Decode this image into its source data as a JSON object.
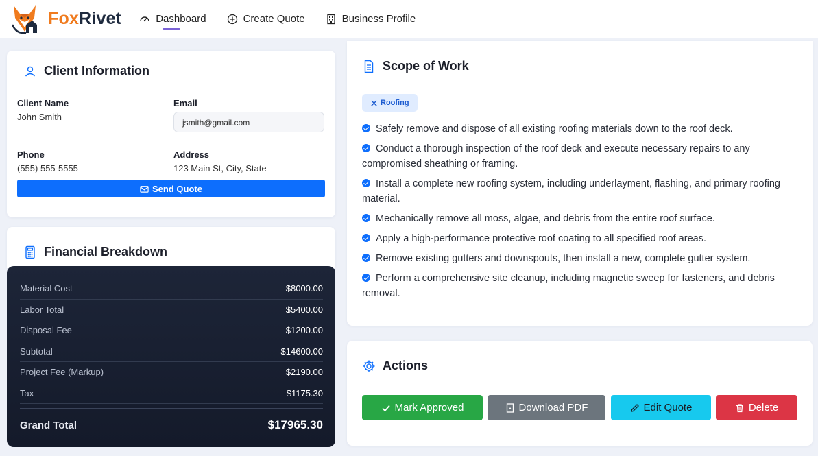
{
  "brand": {
    "name_part1": "Fox",
    "name_part2": "Rivet",
    "accent": "#f07b1e",
    "dark": "#1e2a3e"
  },
  "nav": [
    {
      "label": "Dashboard",
      "icon": "gauge-icon",
      "active": true
    },
    {
      "label": "Create Quote",
      "icon": "plus-circle-icon"
    },
    {
      "label": "Business Profile",
      "icon": "building-icon"
    }
  ],
  "client": {
    "title": "Client Information",
    "name_label": "Client Name",
    "name": "John Smith",
    "email_label": "Email",
    "email": "jsmith@gmail.com",
    "phone_label": "Phone",
    "phone": "(555) 555-5555",
    "address_label": "Address",
    "address": "123 Main St, City, State",
    "send_label": "Send Quote"
  },
  "financial": {
    "title": "Financial Breakdown",
    "rows": [
      {
        "label": "Material Cost",
        "value": "$8000.00"
      },
      {
        "label": "Labor Total",
        "value": "$5400.00"
      },
      {
        "label": "Disposal Fee",
        "value": "$1200.00"
      },
      {
        "label": "Subtotal",
        "value": "$14600.00"
      },
      {
        "label": "Project Fee (Markup)",
        "value": "$2190.00"
      },
      {
        "label": "Tax",
        "value": "$1175.30"
      }
    ],
    "total_label": "Grand Total",
    "total_value": "$17965.30"
  },
  "scope": {
    "title": "Scope of Work",
    "tag": "Roofing",
    "items": [
      "Safely remove and dispose of all existing roofing materials down to the roof deck.",
      "Conduct a thorough inspection of the roof deck and execute necessary repairs to any compromised sheathing or framing.",
      "Install a complete new roofing system, including underlayment, flashing, and primary roofing material.",
      "Mechanically remove all moss, algae, and debris from the entire roof surface.",
      "Apply a high-performance protective roof coating to all specified roof areas.",
      "Remove existing gutters and downspouts, then install a new, complete gutter system.",
      "Perform a comprehensive site cleanup, including magnetic sweep for fasteners, and debris removal."
    ]
  },
  "actions": {
    "title": "Actions",
    "approve": "Mark Approved",
    "pdf": "Download PDF",
    "edit": "Edit Quote",
    "delete": "Delete"
  }
}
